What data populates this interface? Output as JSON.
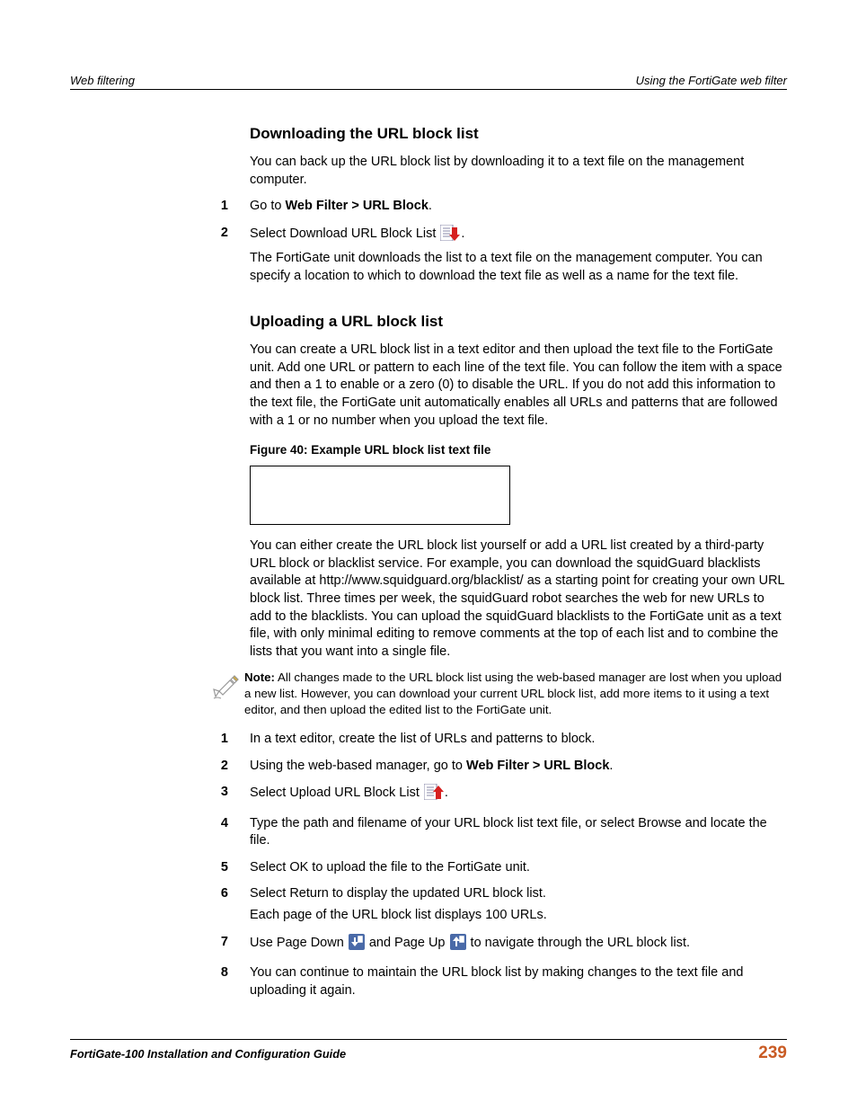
{
  "header": {
    "left": "Web filtering",
    "right": "Using the FortiGate web filter"
  },
  "section1": {
    "heading": "Downloading the URL block list",
    "intro": "You can back up the URL block list by downloading it to a text file on the management computer.",
    "steps": [
      {
        "num": "1",
        "parts": [
          "Go to ",
          "Web Filter > URL Block",
          "."
        ]
      },
      {
        "num": "2",
        "lead": "Select Download URL Block List ",
        "trail": ".",
        "body": "The FortiGate unit downloads the list to a text file on the management computer. You can specify a location to which to download the text file as well as a name for the text file."
      }
    ]
  },
  "section2": {
    "heading": "Uploading a URL block list",
    "intro": "You can create a URL block list in a text editor and then upload the text file to the FortiGate unit. Add one URL or pattern to each line of the text file. You can follow the item with a space and then a 1 to enable or a zero (0) to disable the URL. If you do not add this information to the text file, the FortiGate unit automatically enables all URLs and patterns that are followed with a 1 or no number when you upload the text file.",
    "figure_caption": "Figure 40: Example URL block list text file",
    "para2": "You can either create the URL block list yourself or add a URL list created by a third-party URL block or blacklist service. For example, you can download the squidGuard blacklists available at http://www.squidguard.org/blacklist/ as a starting point for creating your own URL block list. Three times per week, the squidGuard robot searches the web for new URLs to add to the blacklists. You can upload the squidGuard blacklists to the FortiGate unit as a text file, with only minimal editing to remove comments at the top of each list and to combine the lists that you want into a single file.",
    "note_label": "Note:",
    "note_text": " All changes made to the URL block list using the web-based manager are lost when you upload a new list. However, you can download your current URL block list, add more items to it using a text editor, and then upload the edited list to the FortiGate unit.",
    "steps": [
      {
        "num": "1",
        "text": "In a text editor, create the list of URLs and patterns to block."
      },
      {
        "num": "2",
        "parts": [
          "Using the web-based manager, go to ",
          "Web Filter > URL Block",
          "."
        ]
      },
      {
        "num": "3",
        "lead": "Select Upload URL Block List ",
        "trail": "."
      },
      {
        "num": "4",
        "text": "Type the path and filename of your URL block list text file, or select Browse and locate the file."
      },
      {
        "num": "5",
        "text": "Select OK to upload the file to the FortiGate unit."
      },
      {
        "num": "6",
        "text": "Select Return to display the updated URL block list.",
        "text2": "Each page of the URL block list displays 100 URLs."
      },
      {
        "num": "7",
        "lead": "Use Page Down ",
        "mid": " and Page Up ",
        "trail": " to navigate through the URL block list."
      },
      {
        "num": "8",
        "text": "You can continue to maintain the URL block list by making changes to the text file and uploading it again."
      }
    ]
  },
  "footer": {
    "title": "FortiGate-100 Installation and Configuration Guide",
    "page": "239"
  }
}
